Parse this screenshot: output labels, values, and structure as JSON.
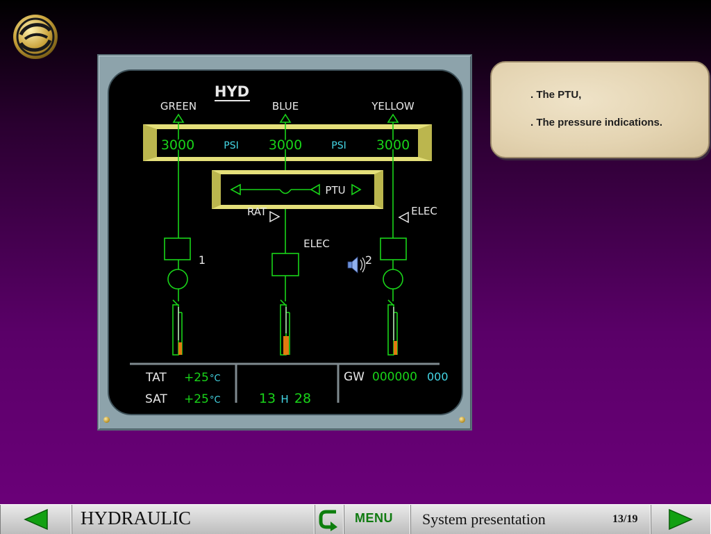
{
  "ecam": {
    "title": "HYD",
    "systems": [
      {
        "name": "GREEN",
        "pressure": "3000"
      },
      {
        "name": "BLUE",
        "pressure": "3000"
      },
      {
        "name": "YELLOW",
        "pressure": "3000"
      }
    ],
    "psi_label_1": "PSI",
    "psi_label_2": "PSI",
    "ptu_label": "PTU",
    "rat_label": "RAT",
    "elec_label_yellow": "ELEC",
    "elec_label_blue": "ELEC",
    "pump_1_label": "1",
    "pump_2_label": "2",
    "tat_label": "TAT",
    "tat_value": "+25",
    "tat_unit": "°C",
    "sat_label": "SAT",
    "sat_value": "+25",
    "sat_unit": "°C",
    "time_hours": "13",
    "time_h": "H",
    "time_minutes": "28",
    "gw_label": "GW",
    "gw_value": "000000",
    "gw_unit": "000"
  },
  "note": {
    "line_1": ". The PTU,",
    "line_2": ". The pressure indications."
  },
  "footer": {
    "module_title": "HYDRAULIC",
    "menu_label": "MENU",
    "section_title": "System presentation",
    "page_indicator": "13/19"
  },
  "colors": {
    "ecam_green": "#19d419",
    "ecam_cyan": "#44d7e6",
    "ecam_white": "#e8e8e8",
    "ecam_amber": "#e07a10",
    "ecam_yellow_box": "#d8d56a",
    "nav_arrow": "#12a012"
  }
}
